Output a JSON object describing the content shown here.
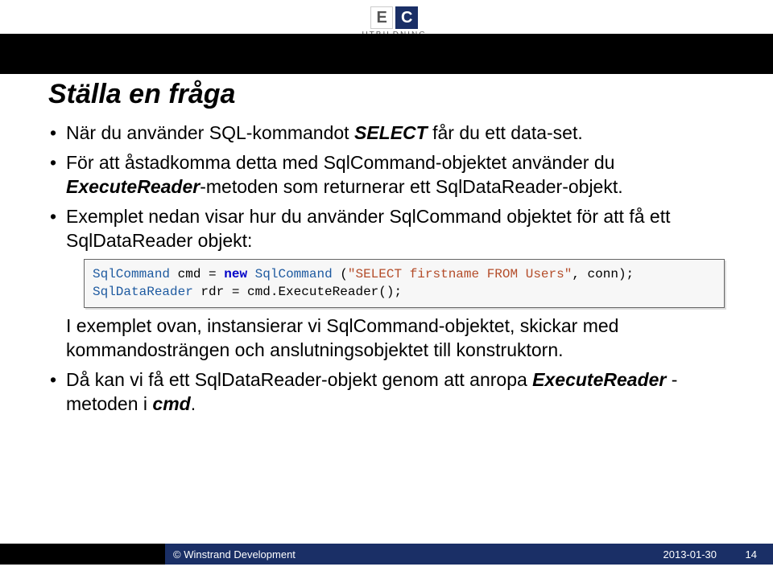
{
  "logo": {
    "e": "E",
    "c": "C",
    "text": "UTBILDNING"
  },
  "title": "Ställa en fråga",
  "bul1_a": "När du använder SQL-kommandot ",
  "bul1_b": "SELECT",
  "bul1_c": " får du ett data-set.",
  "bul2_a": "För att åstadkomma detta med SqlCommand-objektet använder du ",
  "bul2_b": "ExecuteReader",
  "bul2_c": "-metoden som returnerar ett SqlDataReader-objekt.",
  "bul3": "Exemplet nedan visar hur du använder SqlCommand objektet för att få ett SqlDataReader objekt:",
  "code": {
    "t1": "SqlCommand",
    "p1": " cmd = ",
    "kw": "new",
    "p2": " ",
    "t2": "SqlCommand",
    "p3": " (",
    "s1": "\"SELECT firstname FROM Users\"",
    "p4": ", conn);",
    "nl": "\n",
    "t3": "SqlDataReader",
    "p5": " rdr = cmd.ExecuteReader();"
  },
  "sub": "I exemplet ovan, instansierar vi SqlCommand-objektet, skickar med kommandosträngen och anslutningsobjektet till konstruktorn.",
  "bul4_a": "Då kan vi få ett SqlDataReader-objekt genom att anropa ",
  "bul4_b": "ExecuteReader",
  "bul4_c": " -metoden i ",
  "bul4_d": "cmd",
  "bul4_e": ".",
  "footer": {
    "copy": "© Winstrand Development",
    "date": "2013-01-30",
    "page": "14"
  }
}
